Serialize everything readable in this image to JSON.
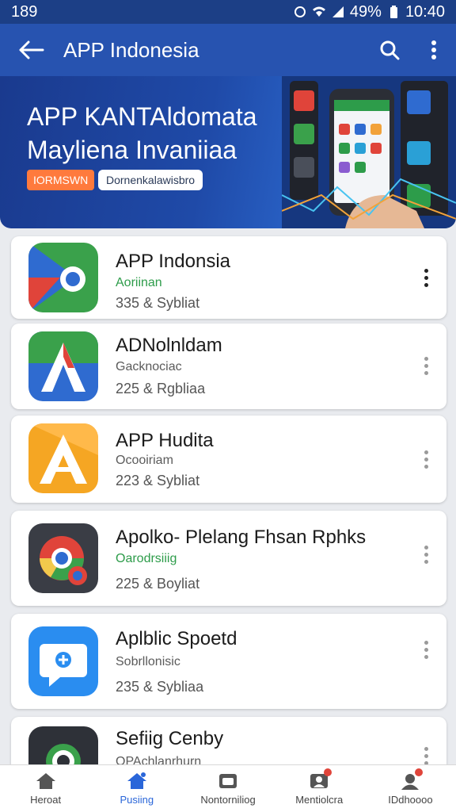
{
  "status_bar": {
    "time_left": "189",
    "battery": "49%",
    "clock": "10:40"
  },
  "appbar": {
    "title": "APP Indonesia"
  },
  "banner": {
    "line1": "APP KANTAldomata",
    "line2": "Mayliena Invaniiaa",
    "pill_orange": "IORMSWN",
    "pill_white": "Dornenkalawisbro"
  },
  "apps": [
    {
      "name": "APP Indonsia",
      "category": "Aoriinan",
      "meta": "335 & Sybliat",
      "category_color": "green"
    },
    {
      "name": "ADNolnldam",
      "category": "Gacknociac",
      "meta": "225 & Rgbliaa",
      "category_color": "gray"
    },
    {
      "name": "APP Hudita",
      "category": "Ocooiriam",
      "meta": "223 & Sybliat",
      "category_color": "gray"
    },
    {
      "name": "Apolko- Plelang Fhsan Rphks",
      "category": "Oarodrsiiig",
      "meta": "225 & Boyliat",
      "category_color": "green"
    },
    {
      "name": "Aplblic Spoetd",
      "category": "Sobrllonisic",
      "meta": "235 & Sybliaa",
      "category_color": "gray"
    },
    {
      "name": "Sefiig Cenby",
      "category": "OPAchlanrhurn",
      "meta": "",
      "category_color": "gray"
    }
  ],
  "bottom_nav": [
    {
      "label": "Heroat",
      "icon": "home-icon",
      "active": false
    },
    {
      "label": "Pusiing",
      "icon": "store-icon",
      "active": true
    },
    {
      "label": "Nontorniliog",
      "icon": "folder-icon",
      "active": false
    },
    {
      "label": "Mentiolcra",
      "icon": "person-badge-icon",
      "active": false
    },
    {
      "label": "IDdhoooo",
      "icon": "user-badge-icon",
      "active": false
    }
  ],
  "colors": {
    "primary": "#2753b0",
    "status": "#1c3f86",
    "accent_blue": "#2a66d9",
    "green": "#2d9c4a",
    "orange": "#ff7a3d"
  }
}
